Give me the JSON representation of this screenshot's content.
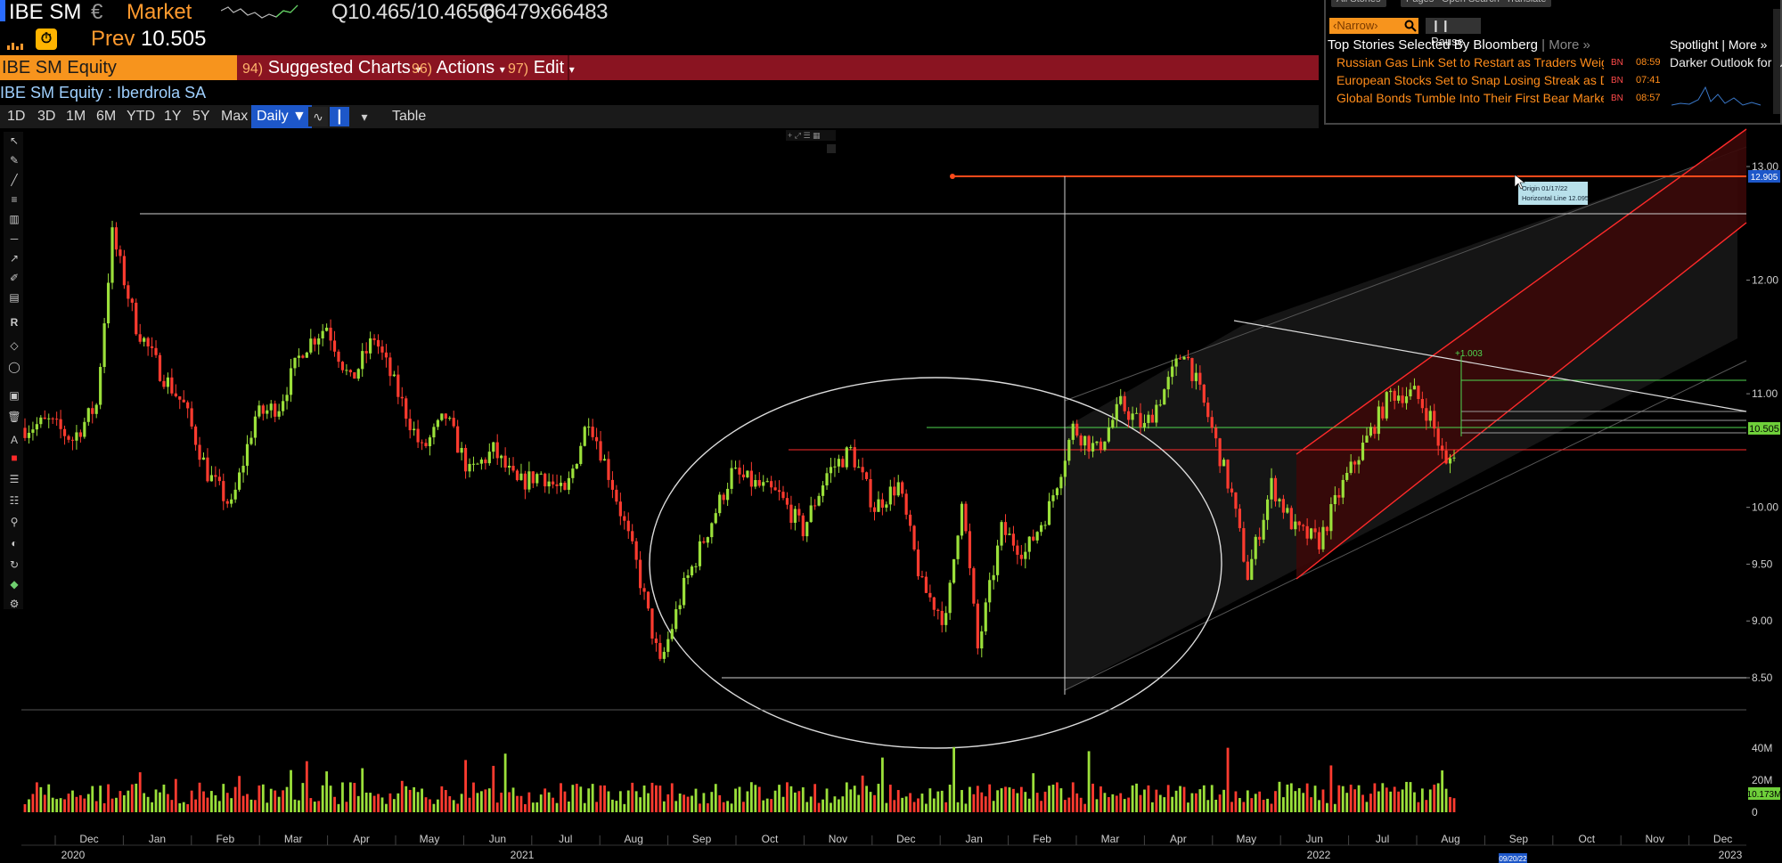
{
  "header": {
    "ticker": "IBE SM",
    "currency": "€",
    "market": "Market",
    "quote": "Q10.465/10.465Q",
    "size": "66479x66483",
    "prev_label": "Prev",
    "prev_value": "10.505"
  },
  "command_bar": {
    "security": "IBE SM Equity",
    "items": [
      {
        "num": "94)",
        "label": "Suggested Charts",
        "arrow": "▾"
      },
      {
        "num": "96)",
        "label": "Actions",
        "arrow": "▾"
      },
      {
        "num": "97)",
        "label": "Edit",
        "arrow": "▾"
      }
    ]
  },
  "security_desc": "IBE SM Equity : Iberdrola SA",
  "periods": [
    "1D",
    "3D",
    "1M",
    "6M",
    "YTD",
    "1Y",
    "5Y",
    "Max"
  ],
  "frequency": "Daily ▼",
  "table_label": "Table",
  "news": {
    "tabs": [
      "All Stories",
      "Pages",
      "Open Search",
      "Translate"
    ],
    "narrow": "‹Narrow›",
    "pause": "❙❙ Pause",
    "title": "Top Stories Selected By Bloomberg",
    "more": "| More »",
    "headlines": [
      {
        "text": "Russian Gas Link Set to Restart as Traders Weighs F...",
        "src": "BN",
        "time": "08:59"
      },
      {
        "text": "European Stocks Set to Snap Losing Streak as Dip B...",
        "src": "BN",
        "time": "07:41"
      },
      {
        "text": "Global Bonds Tumble Into Their First Bear Market in...",
        "src": "BN",
        "time": "08:57"
      }
    ],
    "spotlight_title": "Spotlight | More »",
    "spotlight_text": "Darker Outlook for U"
  },
  "annotation_tooltip": {
    "line1": "Origin 01/17/22",
    "line2": "Horizontal Line 12.095"
  },
  "colors": {
    "up": "#9be03a",
    "down": "#ff3b2f",
    "accent_orange": "#f7941d",
    "command_red": "#8a1421",
    "channel_red": "#ff2a2a"
  },
  "chart_data": {
    "type": "candlestick",
    "price_axis": {
      "ticks": [
        "13.00",
        "12.00",
        "11.00",
        "10.00",
        "9.50",
        "9.00",
        "8.50"
      ],
      "last_price_label": "10.505",
      "top_tag": "12.905"
    },
    "volume_axis": {
      "ticks": [
        "40M",
        "20M",
        "0"
      ],
      "last_volume_label": "10.173M"
    },
    "months": [
      "Dec",
      "Jan",
      "Feb",
      "Mar",
      "Apr",
      "May",
      "Jun",
      "Jul",
      "Aug",
      "Sep",
      "Oct",
      "Nov",
      "Dec",
      "Jan",
      "Feb",
      "Mar",
      "Apr",
      "May",
      "Jun",
      "Jul",
      "Aug",
      "Sep",
      "Oct",
      "Nov",
      "Dec"
    ],
    "years": [
      "2020",
      "2021",
      "2022",
      "2023"
    ],
    "cursor_date": "09/20/22",
    "channel_label": "+1.003",
    "price_path": [
      {
        "i": 0,
        "p": 10.7
      },
      {
        "i": 6,
        "p": 10.75
      },
      {
        "i": 12,
        "p": 10.6
      },
      {
        "i": 18,
        "p": 10.9
      },
      {
        "i": 22,
        "p": 12.4
      },
      {
        "i": 28,
        "p": 11.6
      },
      {
        "i": 34,
        "p": 11.2
      },
      {
        "i": 40,
        "p": 10.9
      },
      {
        "i": 46,
        "p": 10.3
      },
      {
        "i": 52,
        "p": 10.0
      },
      {
        "i": 58,
        "p": 10.8
      },
      {
        "i": 64,
        "p": 10.9
      },
      {
        "i": 70,
        "p": 11.4
      },
      {
        "i": 76,
        "p": 11.6
      },
      {
        "i": 82,
        "p": 11.1
      },
      {
        "i": 88,
        "p": 11.5
      },
      {
        "i": 94,
        "p": 11.0
      },
      {
        "i": 100,
        "p": 10.5
      },
      {
        "i": 106,
        "p": 10.8
      },
      {
        "i": 112,
        "p": 10.3
      },
      {
        "i": 118,
        "p": 10.5
      },
      {
        "i": 124,
        "p": 10.2
      },
      {
        "i": 130,
        "p": 10.3
      },
      {
        "i": 136,
        "p": 10.1
      },
      {
        "i": 142,
        "p": 10.8
      },
      {
        "i": 148,
        "p": 10.2
      },
      {
        "i": 154,
        "p": 9.5
      },
      {
        "i": 160,
        "p": 8.6
      },
      {
        "i": 166,
        "p": 9.3
      },
      {
        "i": 172,
        "p": 9.8
      },
      {
        "i": 178,
        "p": 10.3
      },
      {
        "i": 184,
        "p": 10.2
      },
      {
        "i": 190,
        "p": 10.1
      },
      {
        "i": 196,
        "p": 9.8
      },
      {
        "i": 202,
        "p": 10.3
      },
      {
        "i": 208,
        "p": 10.5
      },
      {
        "i": 214,
        "p": 10.0
      },
      {
        "i": 220,
        "p": 10.2
      },
      {
        "i": 226,
        "p": 9.3
      },
      {
        "i": 232,
        "p": 9.0
      },
      {
        "i": 236,
        "p": 10.1
      },
      {
        "i": 240,
        "p": 8.75
      },
      {
        "i": 246,
        "p": 9.8
      },
      {
        "i": 252,
        "p": 9.6
      },
      {
        "i": 258,
        "p": 10.0
      },
      {
        "i": 264,
        "p": 10.7
      },
      {
        "i": 270,
        "p": 10.5
      },
      {
        "i": 276,
        "p": 10.9
      },
      {
        "i": 282,
        "p": 10.7
      },
      {
        "i": 288,
        "p": 11.1
      },
      {
        "i": 292,
        "p": 11.4
      },
      {
        "i": 298,
        "p": 10.8
      },
      {
        "i": 304,
        "p": 10.1
      },
      {
        "i": 308,
        "p": 9.4
      },
      {
        "i": 314,
        "p": 10.2
      },
      {
        "i": 320,
        "p": 9.8
      },
      {
        "i": 326,
        "p": 9.7
      },
      {
        "i": 332,
        "p": 10.2
      },
      {
        "i": 338,
        "p": 10.6
      },
      {
        "i": 344,
        "p": 11.0
      },
      {
        "i": 350,
        "p": 11.0
      },
      {
        "i": 354,
        "p": 10.8
      },
      {
        "i": 358,
        "p": 10.35
      },
      {
        "i": 360,
        "p": 10.5
      }
    ]
  }
}
